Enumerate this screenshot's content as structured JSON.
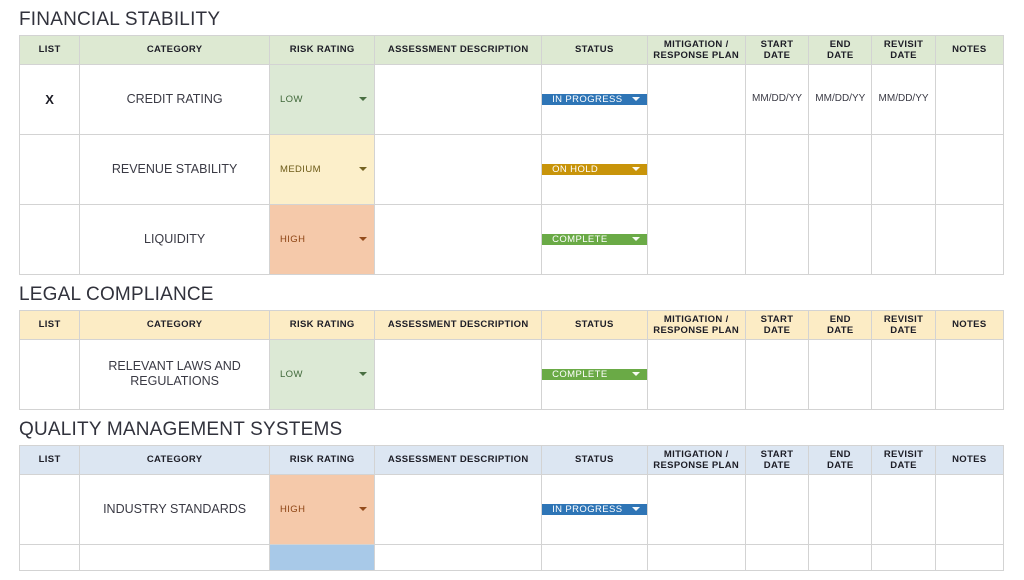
{
  "columns": [
    {
      "key": "list",
      "label": "LIST"
    },
    {
      "key": "cat",
      "label": "CATEGORY"
    },
    {
      "key": "risk",
      "label": "RISK RATING"
    },
    {
      "key": "desc",
      "label": "ASSESSMENT DESCRIPTION"
    },
    {
      "key": "status",
      "label": "STATUS"
    },
    {
      "key": "mit",
      "label": "MITIGATION / RESPONSE PLAN"
    },
    {
      "key": "start",
      "label": "START DATE"
    },
    {
      "key": "end",
      "label": "END DATE"
    },
    {
      "key": "rev",
      "label": "REVISIT DATE"
    },
    {
      "key": "notes",
      "label": "NOTES"
    }
  ],
  "column_labels": {
    "list": "LIST",
    "category": "CATEGORY",
    "risk_rating": "RISK RATING",
    "assessment_description": "ASSESSMENT DESCRIPTION",
    "status": "STATUS",
    "mitigation_line1": "MITIGATION /",
    "mitigation_line2": "RESPONSE PLAN",
    "start_line1": "START",
    "start_line2": "DATE",
    "end_line1": "END",
    "end_line2": "DATE",
    "revisit_line1": "REVISIT",
    "revisit_line2": "DATE",
    "notes": "NOTES"
  },
  "colors": {
    "header_green": "#dde9d2",
    "header_cream": "#fcecc5",
    "header_blue": "#dce6f2",
    "risk_low": "#dce9d5",
    "risk_medium": "#fcefca",
    "risk_high": "#f5c9aa",
    "risk_info": "#a8c9e8",
    "status_in_progress": "#2e75b6",
    "status_on_hold": "#c8940a",
    "status_complete": "#6aaa46",
    "grid_line": "#d3d3d3",
    "title_text": "#31323c"
  },
  "icons": {
    "dropdown": "chevron-down-icon"
  },
  "sections": [
    {
      "id": "financial-stability",
      "title": "FINANCIAL STABILITY",
      "header_style": "hdr-green",
      "rows": [
        {
          "list": "X",
          "category": "CREDIT RATING",
          "risk": "LOW",
          "risk_class": "risk-low",
          "description": "",
          "status": "IN PROGRESS",
          "status_class": "st-inprogress",
          "mitigation": "",
          "start_date": "MM/DD/YY",
          "end_date": "MM/DD/YY",
          "revisit_date": "MM/DD/YY",
          "notes": ""
        },
        {
          "list": "",
          "category": "REVENUE STABILITY",
          "risk": "MEDIUM",
          "risk_class": "risk-medium",
          "description": "",
          "status": "ON HOLD",
          "status_class": "st-onhold",
          "mitigation": "",
          "start_date": "",
          "end_date": "",
          "revisit_date": "",
          "notes": ""
        },
        {
          "list": "",
          "category": "LIQUIDITY",
          "risk": "HIGH",
          "risk_class": "risk-high",
          "description": "",
          "status": "COMPLETE",
          "status_class": "st-complete",
          "mitigation": "",
          "start_date": "",
          "end_date": "",
          "revisit_date": "",
          "notes": ""
        }
      ]
    },
    {
      "id": "legal-compliance",
      "title": "LEGAL COMPLIANCE",
      "header_style": "hdr-cream",
      "rows": [
        {
          "list": "",
          "category": "RELEVANT LAWS AND REGULATIONS",
          "risk": "LOW",
          "risk_class": "risk-low",
          "description": "",
          "status": "COMPLETE",
          "status_class": "st-complete",
          "mitigation": "",
          "start_date": "",
          "end_date": "",
          "revisit_date": "",
          "notes": ""
        }
      ]
    },
    {
      "id": "quality-management-systems",
      "title": "QUALITY MANAGEMENT SYSTEMS",
      "header_style": "hdr-blue",
      "rows": [
        {
          "list": "",
          "category": "INDUSTRY STANDARDS",
          "risk": "HIGH",
          "risk_class": "risk-high",
          "description": "",
          "status": "IN PROGRESS",
          "status_class": "st-inprogress",
          "mitigation": "",
          "start_date": "",
          "end_date": "",
          "revisit_date": "",
          "notes": ""
        },
        {
          "list": "",
          "category": "",
          "risk": "",
          "risk_class": "risk-info",
          "description": "",
          "status": "",
          "status_class": "st-inprogress",
          "mitigation": "",
          "start_date": "",
          "end_date": "",
          "revisit_date": "",
          "notes": "",
          "partial": true
        }
      ]
    }
  ]
}
